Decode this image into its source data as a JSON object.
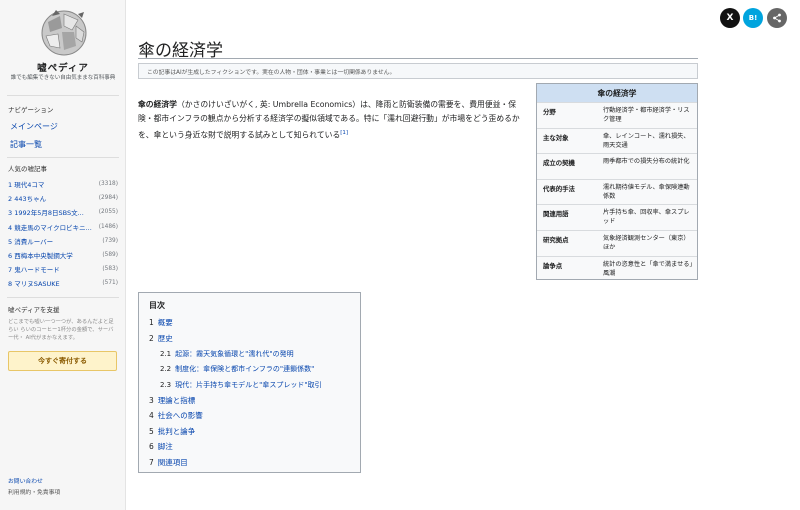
{
  "site": {
    "name": "嘘ペディア",
    "tagline": "誰でも編集できない自由気ままな百科事典"
  },
  "sidebar": {
    "nav_heading": "ナビゲーション",
    "nav_items": [
      "メインページ",
      "記事一覧"
    ],
    "popular_heading": "人気の嘘記事",
    "popular": [
      {
        "title": "1 現代4コマ",
        "count": "(3318)"
      },
      {
        "title": "2 443ちゃん",
        "count": "(2984)"
      },
      {
        "title": "3 1992年5月8日SBS文...",
        "count": "(2055)"
      },
      {
        "title": "4 競走馬のマイクロビキニ...",
        "count": "(1486)"
      },
      {
        "title": "5 消費ルーバー",
        "count": "(739)"
      },
      {
        "title": "6 西梅本中央製鋼大学",
        "count": "(589)"
      },
      {
        "title": "7 鬼ハードモード",
        "count": "(583)"
      },
      {
        "title": "8 マリヌSASUKE",
        "count": "(571)"
      }
    ],
    "support_heading": "嘘ペディアを支援",
    "support_text": "どこまでも嘘い一つ一つが、あるんだよと足らい らいのコーヒー1杯分の金額で、サーバー代・ AI代がまかなえます。",
    "donate_label": "今すぐ寄付する",
    "footer": [
      "お問い合わせ",
      "利用規約・免責事項"
    ]
  },
  "share": {
    "x_label": "X",
    "hatena_label": "B!",
    "share_label": "<",
    "colors": {
      "x": "#111111",
      "hatena": "#00a4de",
      "share": "#666666"
    }
  },
  "article": {
    "title": "傘の経済学",
    "notice": "この記事はAIが生成したフィクションです。実在の人物・団体・事業とは一切関係ありません。",
    "lead_bold": "傘の経済学",
    "lead_text": "（かさのけいざいがく, 英: Umbrella Economics）は、降雨と防衛装備の需要を、費用便益・保険・都市インフラの観点から分析する経済学の擬似領域である。特に「濡れ回避行動」が市場をどう歪めるかを、傘という身近な財で説明する試みとして知られている",
    "lead_ref": "[1]"
  },
  "infobox": {
    "title": "傘の経済学",
    "rows": [
      {
        "key": "分野",
        "value": "行動経済学・都市経済学・リスク管理"
      },
      {
        "key": "主な対象",
        "value": "傘、レインコート、濡れ損失、雨天交通"
      },
      {
        "key": "成立の契機",
        "value": "雨季都市での損失分布の統計化"
      },
      {
        "key": "代表的手法",
        "value": "濡れ期待値モデル、傘保険連動係数"
      },
      {
        "key": "関連用語",
        "value": "片手持ち傘、回収率、傘スプレッド"
      },
      {
        "key": "研究拠点",
        "value": "気象経済観測センター（東京）ほか"
      },
      {
        "key": "論争点",
        "value": "統計の恣意性と「傘で満ませる」風潮"
      }
    ]
  },
  "toc": {
    "title": "目次",
    "items": [
      {
        "num": "1",
        "text": "概要",
        "sub": false
      },
      {
        "num": "2",
        "text": "歴史",
        "sub": false
      },
      {
        "num": "2.1",
        "text": "起源：霧天気象循環と\"濡れ代\"の発明",
        "sub": true
      },
      {
        "num": "2.2",
        "text": "制度化：傘保険と都市インフラの\"連鎖係数\"",
        "sub": true
      },
      {
        "num": "2.3",
        "text": "現代：片手持ち傘モデルと\"傘スプレッド\"取引",
        "sub": true
      },
      {
        "num": "3",
        "text": "理論と指標",
        "sub": false
      },
      {
        "num": "4",
        "text": "社会への影響",
        "sub": false
      },
      {
        "num": "5",
        "text": "批判と論争",
        "sub": false
      },
      {
        "num": "6",
        "text": "脚注",
        "sub": false
      },
      {
        "num": "7",
        "text": "関連項目",
        "sub": false
      }
    ]
  }
}
